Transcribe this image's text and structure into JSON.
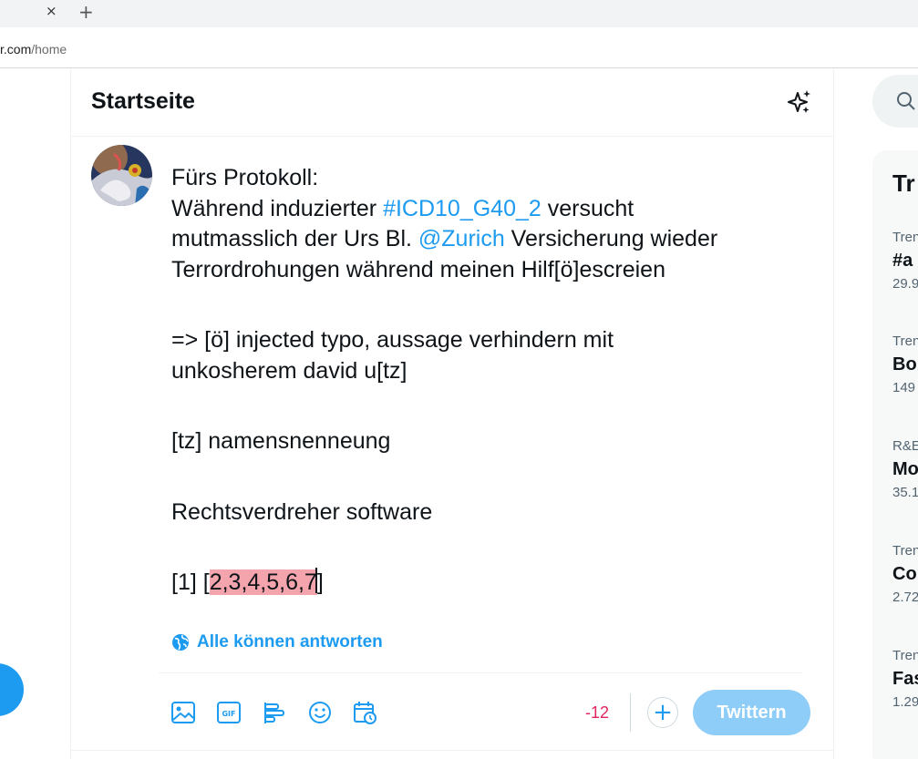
{
  "browser": {
    "tab_close": "×",
    "new_tab": "+",
    "url_host": "r.com",
    "url_path": "/home"
  },
  "header": {
    "title": "Startseite"
  },
  "compose": {
    "text_lines": [
      [
        "Fürs Protokoll:"
      ],
      [
        "Während induzierter ",
        {
          "link": "#ICD10_G40_2"
        },
        " versucht"
      ],
      [
        "mutmasslich der Urs Bl. ",
        {
          "link": "@Zurich"
        },
        " Versicherung wieder"
      ],
      [
        "Terrordrohungen während meinen Hilf[ö]escreien"
      ],
      [],
      [
        "=> [ö] injected typo, aussage verhindern mit"
      ],
      [
        "unkosherem david u[tz]"
      ],
      [],
      [
        "[tz] namensnenneung"
      ],
      [],
      [
        "Rechtsverdreher software"
      ],
      [],
      [
        "[1] [",
        {
          "highlight": "2,3,4,5,6,7"
        },
        {
          "caret": true
        },
        "]"
      ]
    ],
    "reply_setting": "Alle können antworten",
    "char_count": "-12",
    "tweet_button": "Twittern",
    "add_button": "+"
  },
  "trends": {
    "title": "Tr",
    "items": [
      {
        "meta": "Tren",
        "name": "#a",
        "count": "29.9"
      },
      {
        "meta": "Tren",
        "name": "Bo",
        "count": "149"
      },
      {
        "meta": "R&E",
        "name": "Mo",
        "count": "35.1"
      },
      {
        "meta": "Tren",
        "name": "Co",
        "count": "2.72"
      },
      {
        "meta": "Tren",
        "name": "Fas",
        "count": "1.29"
      }
    ]
  },
  "colors": {
    "accent": "#1d9bf0",
    "tweet_button_disabled": "#8ecdf8",
    "highlight": "#f4a4ac",
    "over_limit": "#e0245e"
  },
  "icons": [
    "close-icon",
    "plus-icon",
    "sparkle-icon",
    "globe-icon",
    "image-icon",
    "gif-icon",
    "poll-icon",
    "emoji-icon",
    "schedule-icon",
    "search-icon"
  ]
}
